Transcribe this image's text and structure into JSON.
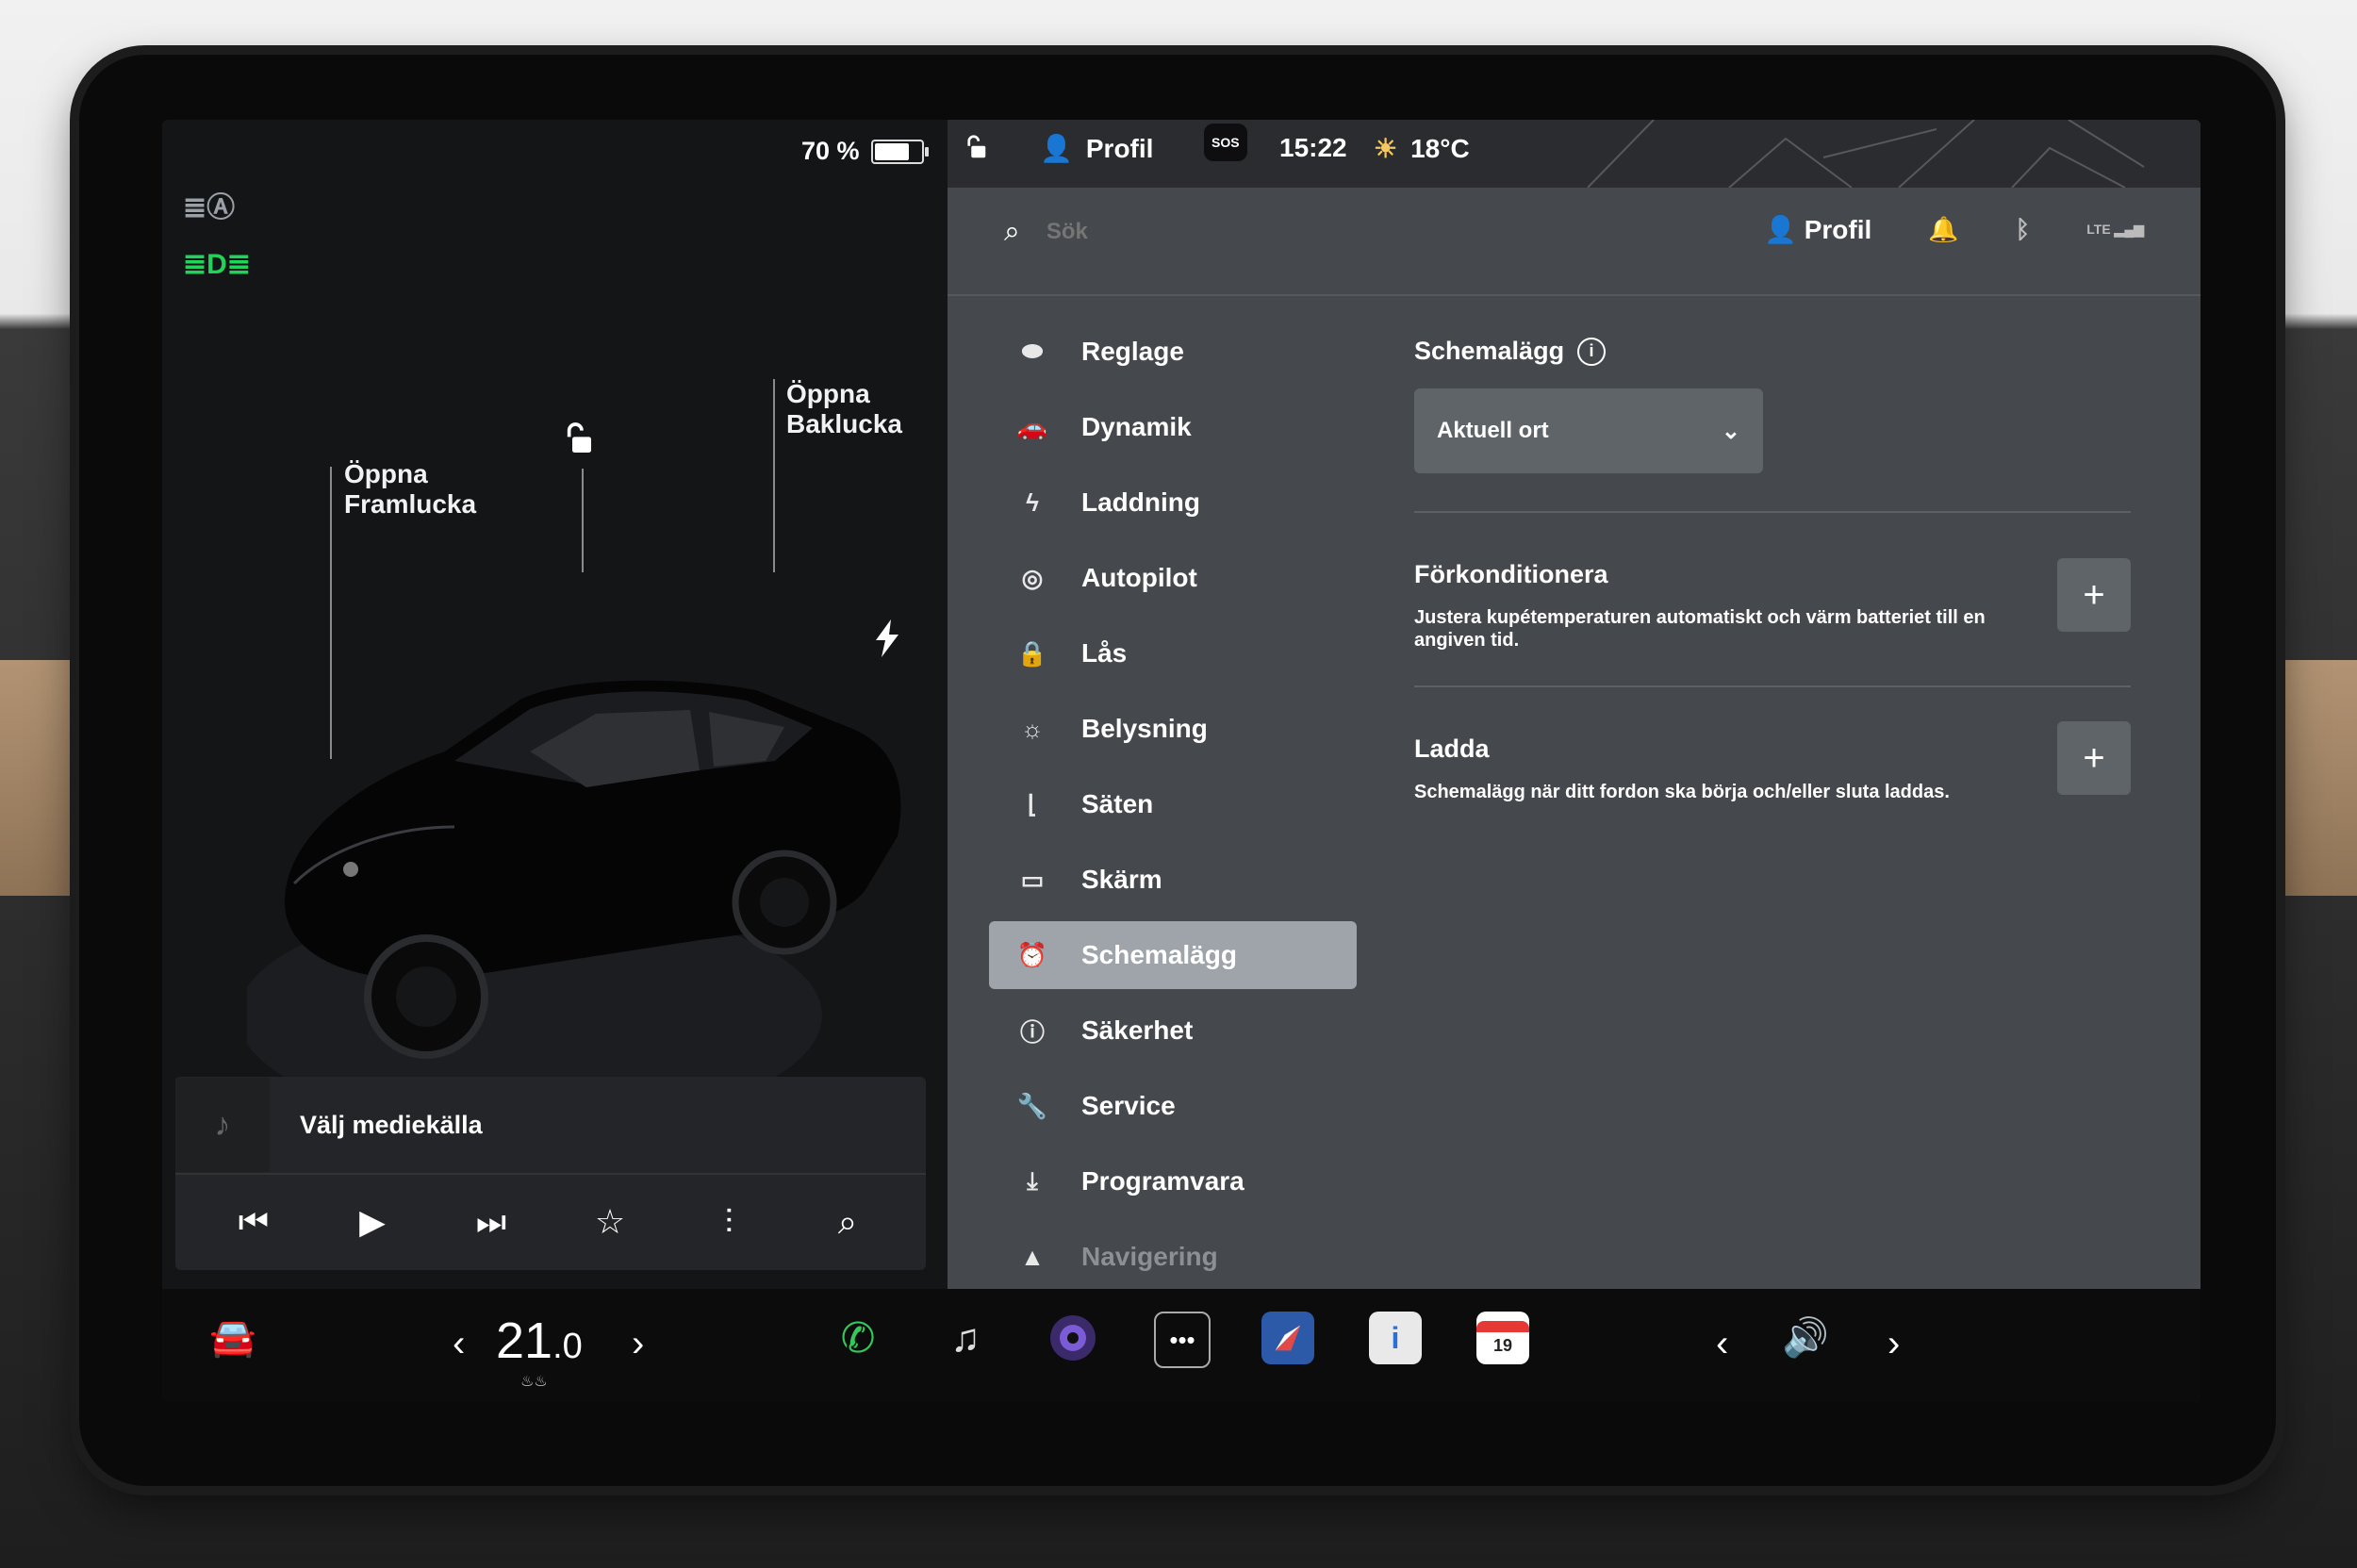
{
  "status": {
    "battery_label": "70 %",
    "battery_level": 0.7,
    "time": "15:22",
    "temperature": "18°C",
    "profile": "Profil",
    "sos_label": "SOS"
  },
  "car": {
    "front_trunk_line1": "Öppna",
    "front_trunk_line2": "Framlucka",
    "rear_trunk_line1": "Öppna",
    "rear_trunk_line2": "Baklucka"
  },
  "media": {
    "source": "Välj mediekälla"
  },
  "header": {
    "search_placeholder": "Sök",
    "profile": "Profil",
    "lte": "LTE"
  },
  "nav": {
    "items": [
      {
        "label": "Reglage",
        "icon": "toggle-icon"
      },
      {
        "label": "Dynamik",
        "icon": "car-icon"
      },
      {
        "label": "Laddning",
        "icon": "bolt-icon"
      },
      {
        "label": "Autopilot",
        "icon": "steering-wheel-icon"
      },
      {
        "label": "Lås",
        "icon": "lock-icon"
      },
      {
        "label": "Belysning",
        "icon": "sun-icon"
      },
      {
        "label": "Säten",
        "icon": "seat-icon"
      },
      {
        "label": "Skärm",
        "icon": "display-icon"
      },
      {
        "label": "Schemalägg",
        "icon": "alarm-clock-icon",
        "active": true
      },
      {
        "label": "Säkerhet",
        "icon": "alert-circle-icon"
      },
      {
        "label": "Service",
        "icon": "wrench-icon"
      },
      {
        "label": "Programvara",
        "icon": "download-icon"
      },
      {
        "label": "Navigering",
        "icon": "navigation-icon"
      }
    ]
  },
  "schedule": {
    "title": "Schemalägg",
    "location_selected": "Aktuell ort",
    "precondition_title": "Förkonditionera",
    "precondition_desc": "Justera kupétemperaturen automatiskt och värm batteriet till en angiven tid.",
    "charge_title": "Ladda",
    "charge_desc": "Schemalägg när ditt fordon ska börja och/eller sluta laddas."
  },
  "bottom": {
    "temp_whole": "21",
    "temp_decimal": ".0",
    "calendar_day": "19"
  },
  "colors": {
    "active_nav": "#9ea4aa",
    "panel": "#45484c",
    "headlight_green": "#22d35a"
  }
}
